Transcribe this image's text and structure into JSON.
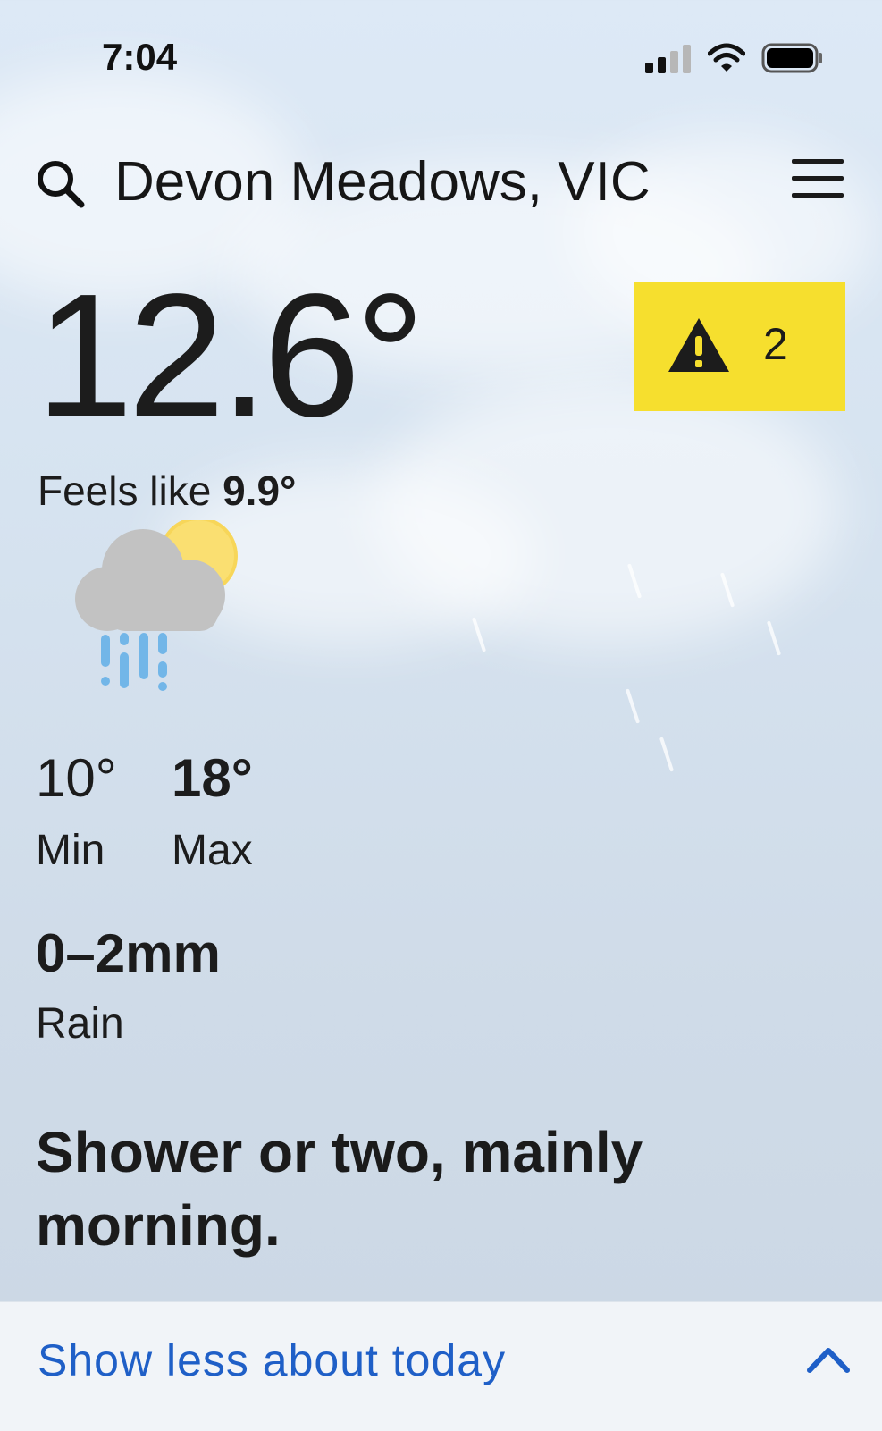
{
  "status_bar": {
    "time": "7:04",
    "signal_icon": "cellular-signal-icon",
    "wifi_icon": "wifi-icon",
    "battery_icon": "battery-icon"
  },
  "header": {
    "location": "Devon Meadows, VIC",
    "search_icon": "search-icon",
    "menu_icon": "hamburger-menu-icon"
  },
  "current": {
    "temperature": "12.6°",
    "feels_like_label": "Feels like",
    "feels_like_value": "9.9°",
    "condition_icon": "partly-cloudy-rain-icon"
  },
  "warnings": {
    "icon": "warning-triangle-icon",
    "count": "2",
    "color": "#f6df2e"
  },
  "forecast": {
    "min_value": "10°",
    "min_label": "Min",
    "max_value": "18°",
    "max_label": "Max",
    "rain_value": "0–2mm",
    "rain_label": "Rain",
    "summary": "Shower or two, mainly morning."
  },
  "bottom_bar": {
    "label": "Show less about today",
    "icon": "chevron-up-icon",
    "link_color": "#1f5fc7"
  }
}
